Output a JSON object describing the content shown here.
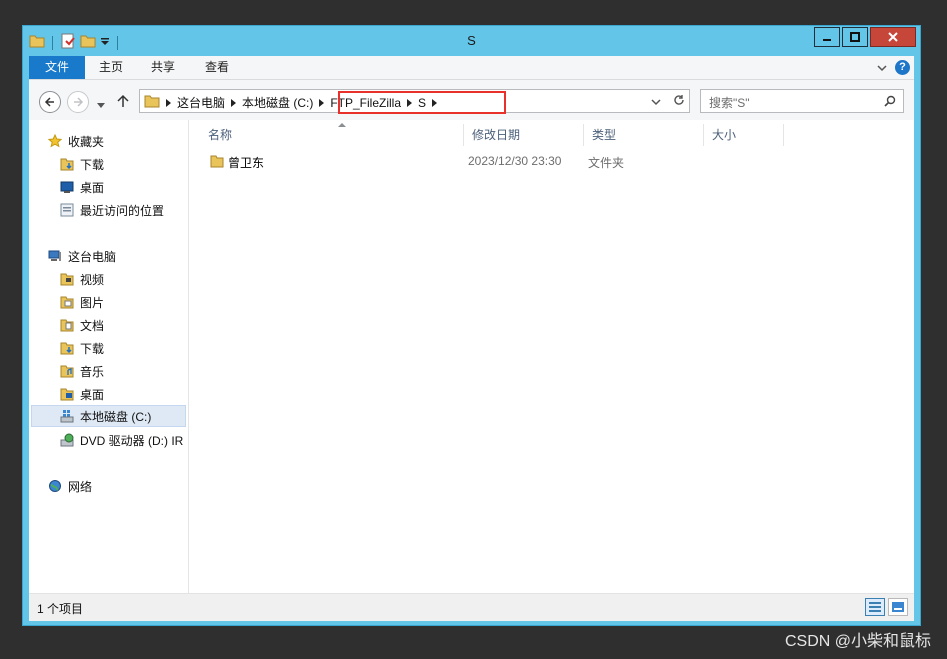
{
  "window": {
    "title": "S"
  },
  "ribbon": {
    "tabs": [
      {
        "label": "文件"
      },
      {
        "label": "主页"
      },
      {
        "label": "共享"
      },
      {
        "label": "查看"
      }
    ]
  },
  "address": {
    "crumbs": [
      "这台电脑",
      "本地磁盘 (C:)",
      "FTP_FileZilla",
      "S"
    ]
  },
  "search": {
    "placeholder": "搜索\"S\""
  },
  "nav": {
    "favorites": {
      "label": "收藏夹"
    },
    "favorites_items": [
      {
        "label": "下载",
        "icon": "downloads-folder-icon"
      },
      {
        "label": "桌面",
        "icon": "desktop-icon"
      },
      {
        "label": "最近访问的位置",
        "icon": "recent-places-icon"
      }
    ],
    "this_pc": {
      "label": "这台电脑"
    },
    "pc_items": [
      {
        "label": "视频",
        "icon": "videos-folder-icon"
      },
      {
        "label": "图片",
        "icon": "pictures-folder-icon"
      },
      {
        "label": "文档",
        "icon": "documents-folder-icon"
      },
      {
        "label": "下载",
        "icon": "downloads-folder-icon"
      },
      {
        "label": "音乐",
        "icon": "music-folder-icon"
      },
      {
        "label": "桌面",
        "icon": "desktop-folder-icon"
      },
      {
        "label": "本地磁盘 (C:)",
        "icon": "local-disk-icon",
        "selected": true
      },
      {
        "label": "DVD 驱动器 (D:) IR",
        "icon": "dvd-drive-icon"
      }
    ],
    "network": {
      "label": "网络"
    }
  },
  "columns": [
    {
      "label": "名称"
    },
    {
      "label": "修改日期"
    },
    {
      "label": "类型"
    },
    {
      "label": "大小"
    }
  ],
  "files": [
    {
      "name": "曾卫东",
      "modified": "2023/12/30 23:30",
      "type": "文件夹",
      "size": ""
    }
  ],
  "status": {
    "count": "1 个项目"
  },
  "watermark": "CSDN @小柴和鼠标",
  "colors": {
    "frame": "#63c5e8",
    "highlight": "#e8312a",
    "file_tab": "#1979ca"
  }
}
